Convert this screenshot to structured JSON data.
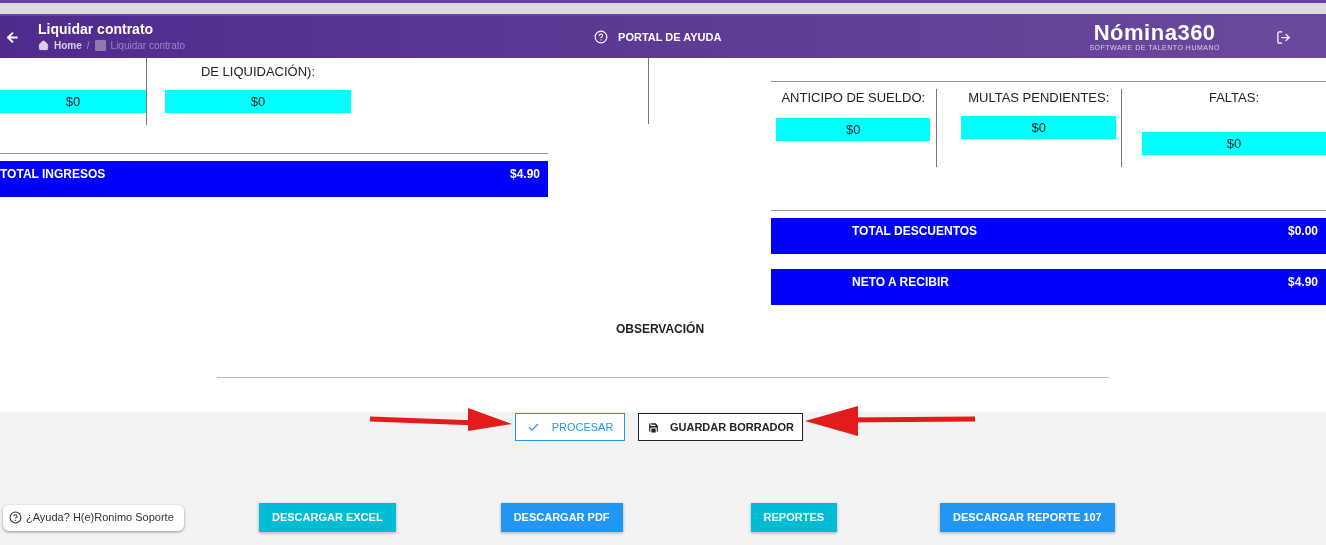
{
  "header": {
    "title": "Liquidar contrato",
    "breadcrumbs": [
      {
        "label": "Home",
        "kind": "home"
      },
      {
        "label": "/",
        "kind": "separator"
      },
      {
        "label": "Liquidar contrato",
        "kind": "current"
      }
    ],
    "help_portal": "PORTAL DE AYUDA",
    "logo": {
      "name": "Nómina360",
      "tagline": "SOFTWARE DE TALENTO HUMANO"
    }
  },
  "income_fields": [
    {
      "value": "$0"
    },
    {
      "label": "DE LIQUIDACIÓN):",
      "value": "$0"
    }
  ],
  "total_income": {
    "label": "TOTAL INGRESOS",
    "value": "$4.90"
  },
  "deduction_fields": [
    {
      "label": "ANTICIPO DE SUELDO:",
      "value": "$0"
    },
    {
      "label": "MULTAS PENDIENTES:",
      "value": "$0"
    },
    {
      "label": "FALTAS:",
      "value": "$0"
    }
  ],
  "totals": [
    {
      "label": "TOTAL DESCUENTOS",
      "value": "$0.00"
    },
    {
      "label": "NETO A RECIBIR",
      "value": "$4.90"
    }
  ],
  "observation_label": "OBSERVACIÓN",
  "actions": [
    {
      "label": "PROCESAR",
      "kind": "process"
    },
    {
      "label": "GUARDAR BORRADOR",
      "kind": "save"
    }
  ],
  "downloads": [
    {
      "label": "DESCARGAR EXCEL",
      "color": "#00bcd4"
    },
    {
      "label": "DESCARGAR PDF",
      "color": "#2196f3"
    },
    {
      "label": "REPORTES",
      "color": "#00bcd4"
    },
    {
      "label": "DESCARGAR REPORTE 107",
      "color": "#2196f3"
    }
  ],
  "help_chip": "¿Ayuda? H(e)Ronimo Soporte"
}
